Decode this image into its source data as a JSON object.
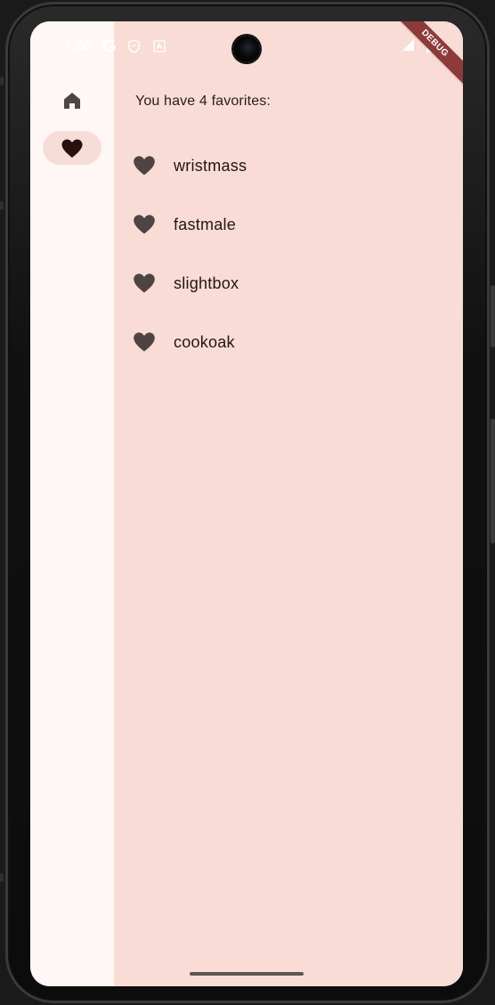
{
  "status_bar": {
    "time": "7:00",
    "google_icon": "google-icon",
    "shield_icon": "shield-icon",
    "a_icon": "a-icon",
    "signal_icon": "signal-icon",
    "battery_icon": "battery-icon",
    "debug_label": "DEBUG"
  },
  "nav": {
    "items": [
      {
        "name": "home",
        "icon": "home-icon",
        "selected": false
      },
      {
        "name": "favorites",
        "icon": "heart-icon",
        "selected": true
      }
    ]
  },
  "main": {
    "heading": "You have 4 favorites:",
    "favorites": [
      {
        "label": "wristmass",
        "icon": "heart-icon"
      },
      {
        "label": "fastmale",
        "icon": "heart-icon"
      },
      {
        "label": "slightbox",
        "icon": "heart-icon"
      },
      {
        "label": "cookoak",
        "icon": "heart-icon"
      }
    ]
  },
  "colors": {
    "content_bg": "#f8dcd5",
    "rail_bg": "#fff7f5",
    "selected_indicator": "#f7ddd8",
    "icon": "#4f4444",
    "text": "#231515",
    "debug_ribbon": "#8f3a3a"
  }
}
